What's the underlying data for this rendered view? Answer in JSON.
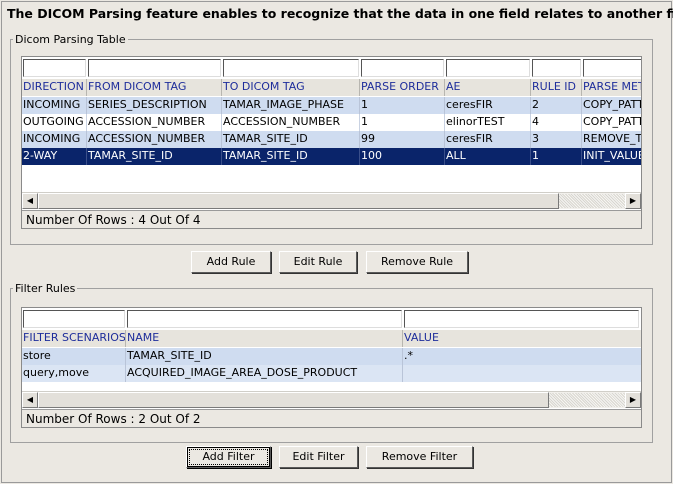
{
  "headline": "The DICOM Parsing feature enables to recognize that the data in one field relates to another field.",
  "parsing_group": {
    "legend": "Dicom Parsing Table",
    "columns": [
      "DIRECTION",
      "FROM DICOM TAG",
      "TO DICOM TAG",
      "PARSE ORDER",
      "AE",
      "RULE ID",
      "PARSE METHOD"
    ],
    "rows": [
      [
        "INCOMING",
        "SERIES_DESCRIPTION",
        "TAMAR_IMAGE_PHASE",
        "1",
        "ceresFIR",
        "2",
        "COPY_PATTERN"
      ],
      [
        "OUTGOING",
        "ACCESSION_NUMBER",
        "ACCESSION_NUMBER",
        "1",
        "elinorTEST",
        "4",
        "COPY_PATTERN"
      ],
      [
        "INCOMING",
        "ACCESSION_NUMBER",
        "TAMAR_SITE_ID",
        "99",
        "ceresFIR",
        "3",
        "REMOVE_TRAILING"
      ],
      [
        "2-WAY",
        "TAMAR_SITE_ID",
        "TAMAR_SITE_ID",
        "100",
        "ALL",
        "1",
        "INIT_VALUE"
      ]
    ],
    "selected_row": 3,
    "status": "Number Of Rows : 4 Out Of 4",
    "buttons": {
      "add": "Add Rule",
      "edit": "Edit Rule",
      "remove": "Remove Rule"
    }
  },
  "filter_group": {
    "legend": "Filter Rules",
    "columns": [
      "FILTER SCENARIOS",
      "NAME",
      "VALUE"
    ],
    "rows": [
      [
        "store",
        "TAMAR_SITE_ID",
        ".*"
      ],
      [
        "query,move",
        "ACQUIRED_IMAGE_AREA_DOSE_PRODUCT",
        ""
      ]
    ],
    "status": "Number Of Rows : 2 Out Of 2",
    "buttons": {
      "add": "Add Filter",
      "edit": "Edit Filter",
      "remove": "Remove Filter"
    }
  }
}
